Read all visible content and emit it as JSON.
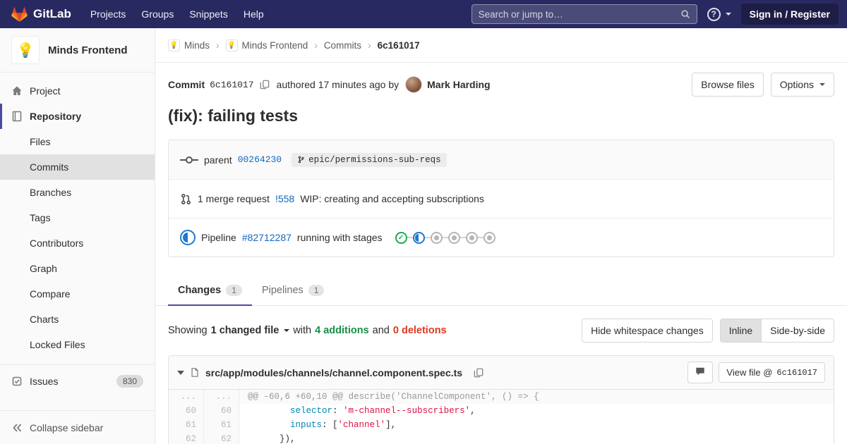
{
  "navbar": {
    "logo_text": "GitLab",
    "menu": [
      "Projects",
      "Groups",
      "Snippets",
      "Help"
    ],
    "search_placeholder": "Search or jump to…",
    "help_glyph": "?",
    "sign_in": "Sign in / Register"
  },
  "sidebar": {
    "project_name": "Minds Frontend",
    "project_item": "Project",
    "repository_item": "Repository",
    "repo_subitems": [
      "Files",
      "Commits",
      "Branches",
      "Tags",
      "Contributors",
      "Graph",
      "Compare",
      "Charts",
      "Locked Files"
    ],
    "active_subitem": "Commits",
    "issues_label": "Issues",
    "issues_count": "830",
    "collapse_label": "Collapse sidebar"
  },
  "breadcrumb": {
    "items": [
      {
        "label": "Minds",
        "avatar": true
      },
      {
        "label": "Minds Frontend",
        "avatar": true
      },
      {
        "label": "Commits",
        "avatar": false
      }
    ],
    "current": "6c161017",
    "separator_glyph": "›"
  },
  "commit": {
    "label": "Commit",
    "sha": "6c161017",
    "authored_text": "authored",
    "time": "17 minutes ago",
    "by_text": "by",
    "author": "Mark Harding",
    "browse_files": "Browse files",
    "options": "Options",
    "title": "(fix): failing tests",
    "parent_label": "parent",
    "parent_sha": "00264230",
    "branch_badge": "epic/permissions-sub-reqs",
    "mr_count_text": "1 merge request",
    "mr_ref": "!558",
    "mr_title": "WIP: creating and accepting subscriptions",
    "pipeline_label": "Pipeline",
    "pipeline_id": "#82712287",
    "pipeline_status_text": "running with stages",
    "pipeline_stages": [
      "success",
      "running",
      "created",
      "created",
      "created",
      "created"
    ]
  },
  "tabs": [
    {
      "label": "Changes",
      "count": "1",
      "active": true
    },
    {
      "label": "Pipelines",
      "count": "1",
      "active": false
    }
  ],
  "diffstats": {
    "showing": "Showing",
    "changed_files": "1 changed file",
    "with_text": "with",
    "additions": "4 additions",
    "and_text": "and",
    "deletions": "0 deletions",
    "hide_whitespace": "Hide whitespace changes",
    "inline": "Inline",
    "side_by_side": "Side-by-side"
  },
  "file": {
    "path": "src/app/modules/channels/channel.component.spec.ts",
    "view_file_prefix": "View file @",
    "view_file_sha": "6c161017"
  },
  "icons": {
    "avatar_glyph": "💡",
    "check_glyph": "✓"
  },
  "colors": {
    "navbar": "#292961",
    "accent": "#4b4ba3",
    "link": "#1068bf",
    "success": "#1aaa55",
    "running": "#1f78d1",
    "added": "#168f48",
    "removed": "#db3b21"
  },
  "diff": {
    "rows": [
      {
        "old": "...",
        "new": "...",
        "hunk": true,
        "segments": [
          {
            "c": "p",
            "t": "@@ -60,6 +60,10 @@ describe('ChannelComponent', () => {"
          }
        ]
      },
      {
        "old": "60",
        "new": "60",
        "segments": [
          {
            "c": "p",
            "t": "        "
          },
          {
            "c": "k",
            "t": "selector"
          },
          {
            "c": "p",
            "t": ": "
          },
          {
            "c": "s",
            "t": "'m-channel--subscribers'"
          },
          {
            "c": "p",
            "t": ","
          }
        ]
      },
      {
        "old": "61",
        "new": "61",
        "segments": [
          {
            "c": "p",
            "t": "        "
          },
          {
            "c": "k",
            "t": "inputs"
          },
          {
            "c": "p",
            "t": ": ["
          },
          {
            "c": "s",
            "t": "'channel'"
          },
          {
            "c": "p",
            "t": "],"
          }
        ]
      },
      {
        "old": "62",
        "new": "62",
        "segments": [
          {
            "c": "p",
            "t": "      }),"
          }
        ]
      }
    ]
  }
}
